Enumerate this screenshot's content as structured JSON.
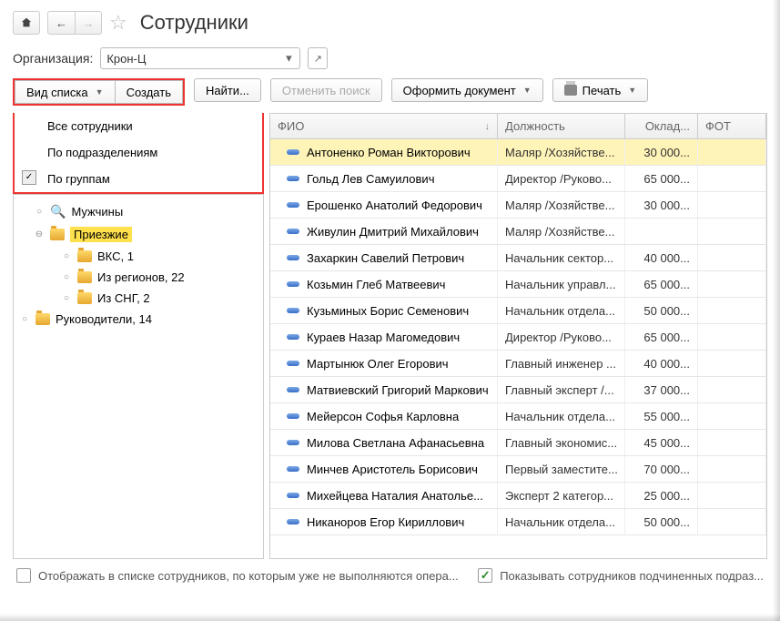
{
  "header": {
    "title": "Сотрудники"
  },
  "org": {
    "label": "Организация:",
    "value": "Крон-Ц"
  },
  "toolbar": {
    "view_list": "Вид списка",
    "create": "Создать",
    "find": "Найти...",
    "cancel_search": "Отменить поиск",
    "make_doc": "Оформить документ",
    "print": "Печать"
  },
  "dropdown": {
    "items": [
      {
        "label": "Все сотрудники",
        "checked": false
      },
      {
        "label": "По подразделениям",
        "checked": false
      },
      {
        "label": "По группам",
        "checked": true
      }
    ]
  },
  "tree": [
    {
      "label": "Мужчины",
      "level": 1,
      "icon": "mag",
      "exp": "o"
    },
    {
      "label": "Приезжие",
      "level": 1,
      "icon": "folder",
      "exp": "minus",
      "hl": true
    },
    {
      "label": "ВКС, 1",
      "level": 2,
      "icon": "folder",
      "exp": "o"
    },
    {
      "label": "Из регионов, 22",
      "level": 2,
      "icon": "folder",
      "exp": "o"
    },
    {
      "label": "Из СНГ, 2",
      "level": 2,
      "icon": "folder",
      "exp": "o"
    },
    {
      "label": "Руководители, 14",
      "level": 0,
      "icon": "folder",
      "exp": "o"
    }
  ],
  "grid": {
    "columns": {
      "fio": "ФИО",
      "pos": "Должность",
      "sal": "Оклад...",
      "foto": "ФОТ"
    },
    "rows": [
      {
        "fio": "Антоненко Роман Викторович",
        "pos": "Маляр /Хозяйстве...",
        "sal": "30 000...",
        "sel": true
      },
      {
        "fio": "Гольд Лев Самуилович",
        "pos": "Директор /Руково...",
        "sal": "65 000..."
      },
      {
        "fio": "Ерошенко Анатолий Федорович",
        "pos": "Маляр /Хозяйстве...",
        "sal": "30 000..."
      },
      {
        "fio": "Живулин Дмитрий Михайлович",
        "pos": "Маляр /Хозяйстве...",
        "sal": ""
      },
      {
        "fio": "Захаркин Савелий Петрович",
        "pos": "Начальник сектор...",
        "sal": "40 000..."
      },
      {
        "fio": "Козьмин Глеб Матвеевич",
        "pos": "Начальник управл...",
        "sal": "65 000..."
      },
      {
        "fio": "Кузьминых Борис Семенович",
        "pos": "Начальник отдела...",
        "sal": "50 000..."
      },
      {
        "fio": "Кураев Назар Магомедович",
        "pos": "Директор /Руково...",
        "sal": "65 000..."
      },
      {
        "fio": "Мартынюк Олег Егорович",
        "pos": "Главный инженер ...",
        "sal": "40 000..."
      },
      {
        "fio": "Матвиевский Григорий Маркович",
        "pos": "Главный эксперт /...",
        "sal": "37 000..."
      },
      {
        "fio": "Мейерсон Софья Карловна",
        "pos": "Начальник отдела...",
        "sal": "55 000..."
      },
      {
        "fio": "Милова Светлана Афанасьевна",
        "pos": "Главный экономис...",
        "sal": "45 000..."
      },
      {
        "fio": "Минчев Аристотель Борисович",
        "pos": "Первый заместите...",
        "sal": "70 000..."
      },
      {
        "fio": "Михейцева Наталия Анатолье...",
        "pos": "Эксперт 2 категор...",
        "sal": "25 000..."
      },
      {
        "fio": "Никаноров Егор Кириллович",
        "pos": "Начальник отдела...",
        "sal": "50 000..."
      }
    ]
  },
  "footer": {
    "left": "Отображать в списке сотрудников, по которым уже не выполняются опера...",
    "right": "Показывать сотрудников подчиненных подраз..."
  }
}
